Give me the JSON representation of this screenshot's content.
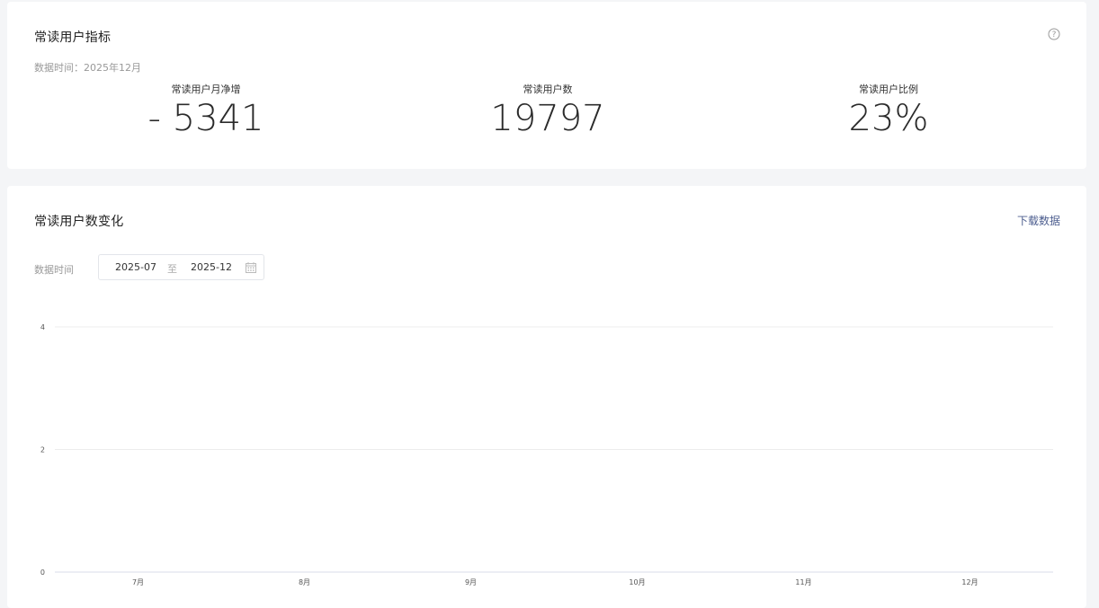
{
  "metrics_card": {
    "title": "常读用户指标",
    "data_time": "数据时间：2025年12月",
    "items": [
      {
        "label": "常读用户月净增",
        "value": "- 5341"
      },
      {
        "label": "常读用户数",
        "value": "19797"
      },
      {
        "label": "常读用户比例",
        "value": "23%"
      }
    ]
  },
  "trend_card": {
    "title": "常读用户数变化",
    "download_label": "下载数据",
    "filter_label": "数据时间",
    "date_start": "2025-07",
    "date_separator": "至",
    "date_end": "2025-12"
  },
  "chart_data": {
    "type": "line",
    "categories": [
      "7月",
      "8月",
      "9月",
      "10月",
      "11月",
      "12月"
    ],
    "series": [],
    "yticks": [
      0,
      2,
      4
    ],
    "ylim": [
      0,
      4
    ],
    "grid": true
  },
  "colors": {
    "link": "#4d5e8f",
    "background": "#f4f5f7",
    "gridline": "#ececec"
  },
  "icons": {
    "help": "help-circle-icon",
    "calendar": "calendar-icon"
  }
}
